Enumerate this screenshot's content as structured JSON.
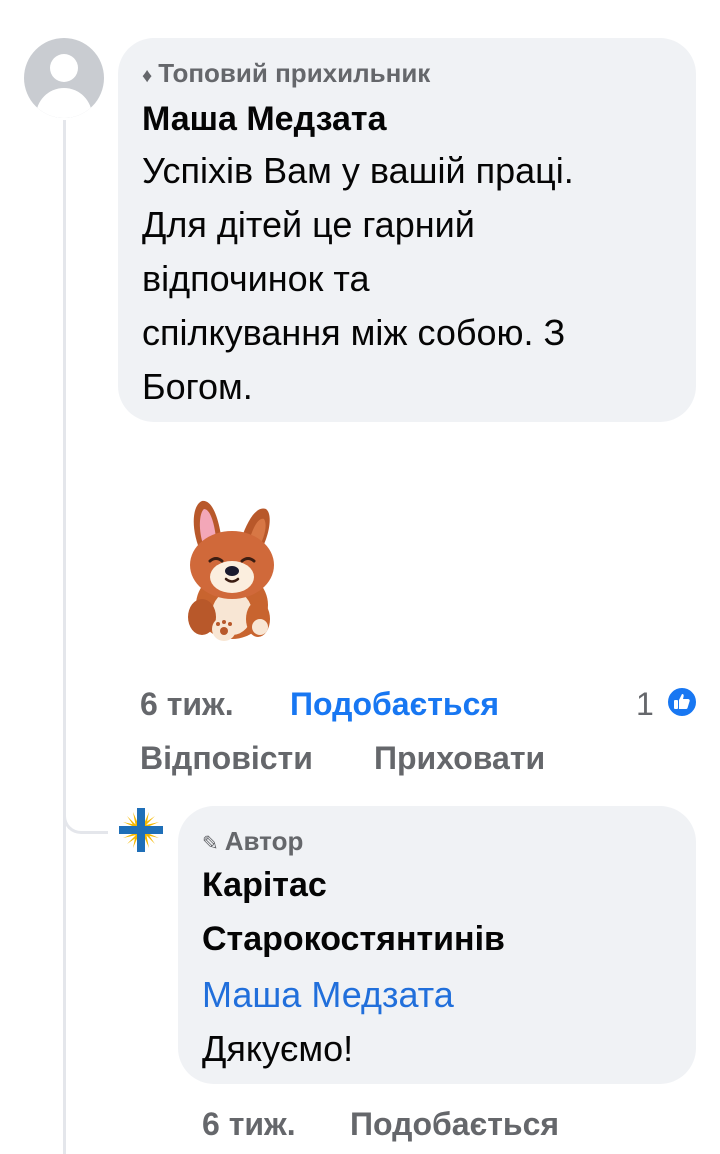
{
  "comment": {
    "badge": "Топовий прихильник",
    "badge_icon": "diamond-icon",
    "author": "Маша Медзата",
    "text_lines": [
      "Успіхів Вам у вашій праці.",
      "Для дітей це гарний",
      "відпочинок та",
      "спілкування між собою. З",
      "Богом."
    ],
    "sticker": "puppy-sticker",
    "time": "6 тиж.",
    "like_label": "Подобається",
    "reply_label": "Відповісти",
    "hide_label": "Приховати",
    "reaction_count": "1",
    "reaction_icon": "like-thumb-icon"
  },
  "reply": {
    "badge": "Автор",
    "badge_icon": "pencil-icon",
    "author_line1": "Карітас",
    "author_line2": "Старокостянтинів",
    "mention": "Маша Медзата",
    "text": "Дякуємо!",
    "time": "6 тиж.",
    "like_label": "Подобається"
  },
  "colors": {
    "bubble": "#f0f2f5",
    "link_blue": "#1877f2",
    "mention_blue": "#216fdb",
    "secondary_text": "#65676b"
  }
}
